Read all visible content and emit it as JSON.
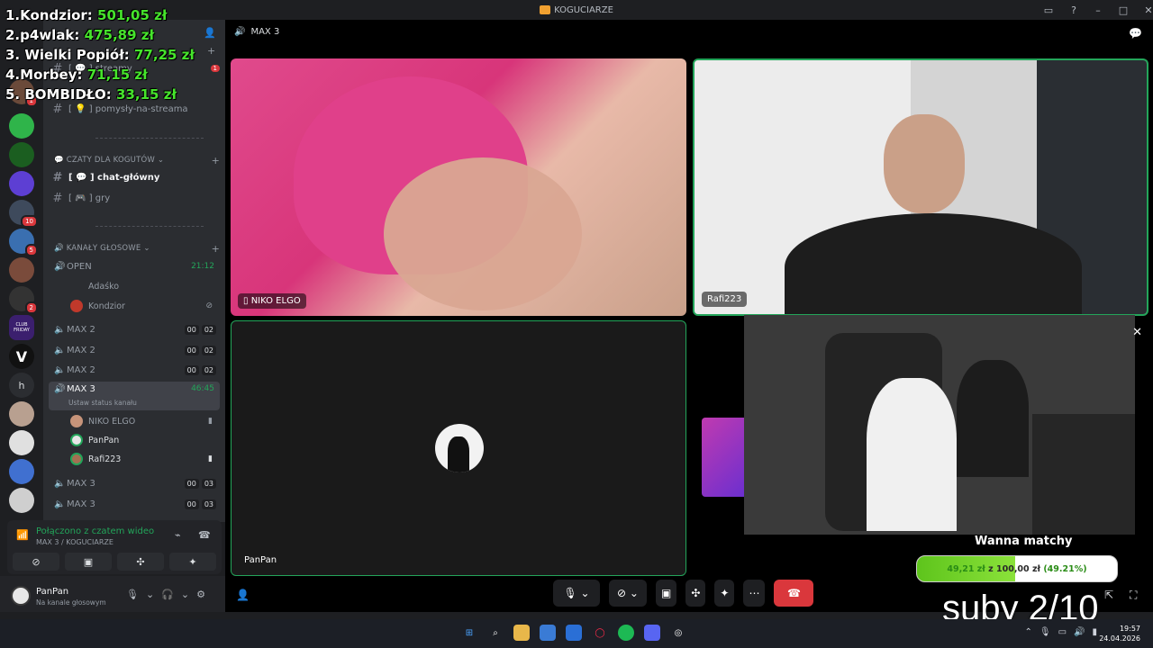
{
  "window": {
    "title": "KOGUCIARZE"
  },
  "leaderboard": [
    {
      "rank": "1.",
      "name": "Kondzior:",
      "amount": "501,05 zł"
    },
    {
      "rank": "2.",
      "name": "p4wlak:",
      "amount": "475,89 zł"
    },
    {
      "rank": "3.",
      "name": "Wielki Popiół:",
      "amount": "77,25 zł"
    },
    {
      "rank": "4.",
      "name": "Morbey:",
      "amount": "71,15 zł"
    },
    {
      "rank": "5.",
      "name": "BOMBIDŁO:",
      "amount": "33,15 zł"
    }
  ],
  "sidebar": {
    "channels_top": [
      {
        "label": "[ 💬 ] streamy"
      },
      {
        "label": "[ 💡 ] pomysły-na-streama"
      }
    ],
    "category_chats": "CZATY DLA KOGUTÓW",
    "chat_channels": [
      {
        "label": "[ 💬 ] chat-główny"
      },
      {
        "label": "[ 🎮 ] gry"
      }
    ],
    "category_voice": "KANAŁY GŁOSOWE",
    "voice_channels": [
      {
        "label": "OPEN",
        "timer": "21:12"
      },
      {
        "label": "MAX 2",
        "a": "00",
        "b": "02"
      },
      {
        "label": "MAX 2",
        "a": "00",
        "b": "02"
      },
      {
        "label": "MAX 2",
        "a": "00",
        "b": "02"
      },
      {
        "label": "MAX 3",
        "timer": "46:45",
        "status": "Ustaw status kanału"
      },
      {
        "label": "MAX 3",
        "a": "00",
        "b": "03"
      },
      {
        "label": "MAX 3",
        "a": "00",
        "b": "03"
      }
    ],
    "open_users": [
      "Adaśko",
      "Kondzior"
    ],
    "max3_users": [
      "NIKO ELGO",
      "PanPan",
      "Rafi223"
    ],
    "badge_count": "1"
  },
  "voice_panel": {
    "connected": "Połączono z czatem wideo",
    "location": "MAX 3 / KOGUCIARZE"
  },
  "user": {
    "name": "PanPan",
    "status": "Na kanale głosowym"
  },
  "call": {
    "header": "MAX 3",
    "tiles": [
      "NIKO ELGO",
      "Rafi223",
      "PanPan"
    ]
  },
  "goal": {
    "title": "Wanna matchy",
    "current": "49,21 zł",
    "of": "z",
    "target": "100,00 zł",
    "percent_label": "(49.21%)",
    "fraction": 0.4921
  },
  "subs": "suby 2/10",
  "taskbar": {
    "time": "19:57",
    "date": "24.04.2026"
  },
  "server_badges": [
    "1",
    "10",
    "5",
    "2"
  ],
  "server_labels": {
    "h": "h",
    "v": "V",
    "club": "CLUB FRIDAY"
  }
}
